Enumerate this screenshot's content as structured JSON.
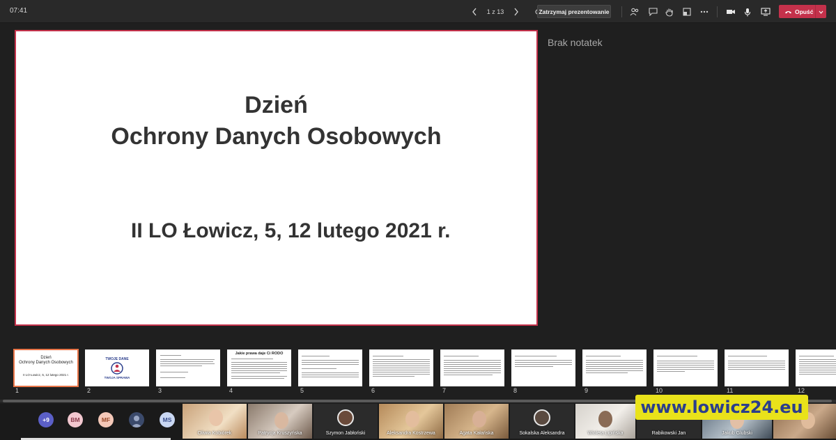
{
  "toolbar": {
    "time": "07:41",
    "page_indicator": "1 z 13",
    "stop_presenting_label": "Zatrzymaj prezentowanie",
    "leave_label": "Opuść"
  },
  "slide": {
    "title_line1": "Dzień",
    "title_line2": "Ochrony Danych Osobowych",
    "subtitle": "II LO Łowicz, 5, 12 lutego 2021 r."
  },
  "notes": {
    "empty_text": "Brak notatek"
  },
  "thumbnails": [
    {
      "num": "1",
      "title": "Dzień\nOchrony Danych Osobowych",
      "sub": "II LO Łowicz, 5, 12 lutego 2021 r."
    },
    {
      "num": "2",
      "title": "TWOJE DANE",
      "sub": "TWOJA SPRAWA"
    },
    {
      "num": "3",
      "title": ""
    },
    {
      "num": "4",
      "title": "Jakie prawa daje Ci RODO"
    },
    {
      "num": "5",
      "title": ""
    },
    {
      "num": "6",
      "title": ""
    },
    {
      "num": "7",
      "title": ""
    },
    {
      "num": "8",
      "title": ""
    },
    {
      "num": "9",
      "title": ""
    },
    {
      "num": "10",
      "title": ""
    },
    {
      "num": "11",
      "title": ""
    },
    {
      "num": "12",
      "title": ""
    }
  ],
  "participants": {
    "overflow": "+9",
    "avatars": [
      {
        "initials": "BM",
        "bg": "#f2c7cf",
        "fg": "#8a3b4b"
      },
      {
        "initials": "MF",
        "bg": "#f4c8b8",
        "fg": "#9a4a2a"
      },
      {
        "initials": "MS",
        "bg": "#c9d7f2",
        "fg": "#3a4f8c"
      }
    ],
    "tiles": [
      {
        "name": "Oliwia Kobiórek"
      },
      {
        "name": "Patrycja Kruszyńska"
      },
      {
        "name": "Szymon Jabłoński"
      },
      {
        "name": "Aleksandra Kostrzewa"
      },
      {
        "name": "Agata Kałańska"
      },
      {
        "name": "Sokalska Aleksandra"
      },
      {
        "name": "Wioleta Lipińska"
      },
      {
        "name": "Rabikowski Jan"
      },
      {
        "name": "Jakub Glubski"
      }
    ]
  },
  "watermark": "www.lowicz24.eu",
  "colors": {
    "accent": "#c4314b",
    "active_thumb": "#e97548",
    "bg": "#1f1f1f"
  }
}
